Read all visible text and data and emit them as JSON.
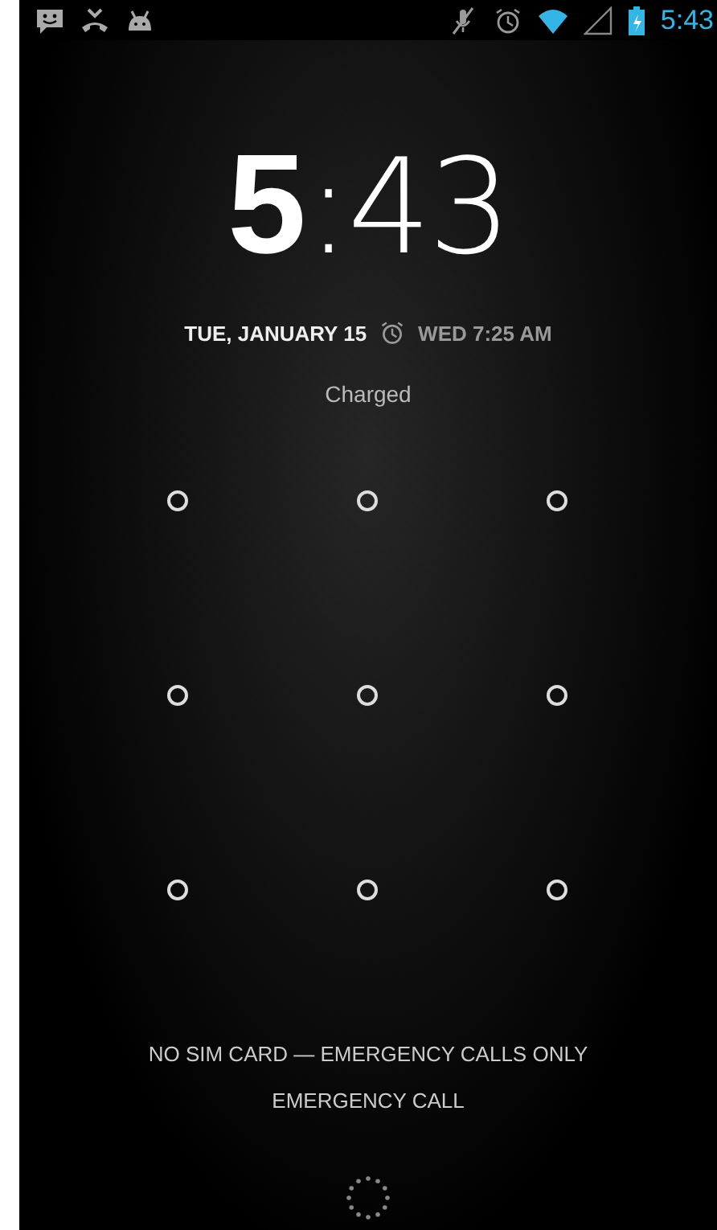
{
  "status_bar": {
    "time": "5:43"
  },
  "clock": {
    "hours": "5",
    "minutes": ":43"
  },
  "date": "TUE, JANUARY 15",
  "alarm": "WED 7:25 AM",
  "charging_status": "Charged",
  "carrier_text": "NO SIM CARD — EMERGENCY CALLS ONLY",
  "emergency_button": "EMERGENCY CALL"
}
